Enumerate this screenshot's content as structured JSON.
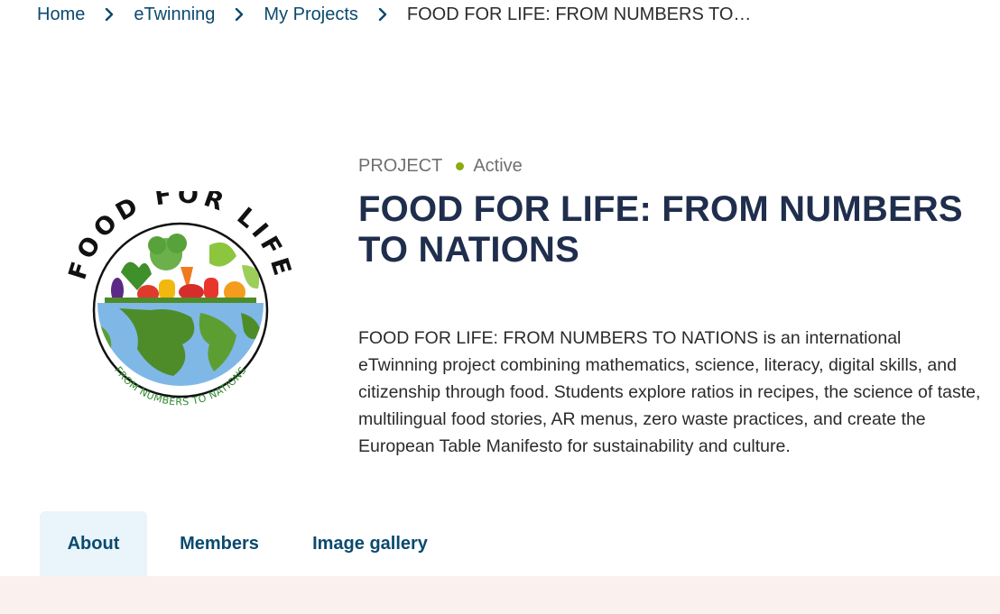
{
  "breadcrumb": {
    "items": [
      "Home",
      "eTwinning",
      "My Projects"
    ],
    "current": "FOOD FOR LIFE: FROM NUMBERS TO…"
  },
  "project": {
    "type_label": "PROJECT",
    "status": "Active",
    "status_color": "#8bab12",
    "title": "FOOD FOR LIFE: FROM NUMBERS TO NATIONS",
    "description": "FOOD FOR LIFE: FROM NUMBERS TO NATIONS is an international eTwinning project combining mathematics, science, literacy, digital skills, and citizenship through food. Students explore ratios in recipes, the science of taste, multilingual food stories, AR menus, zero waste practices, and create the European Table Manifesto for sustainability and culture."
  },
  "logo": {
    "top_text": "FOOD FOR LIFE",
    "bottom_text": "FROM NUMBERS TO NATIONS"
  },
  "tabs": [
    {
      "label": "About",
      "active": true
    },
    {
      "label": "Members",
      "active": false
    },
    {
      "label": "Image gallery",
      "active": false
    }
  ],
  "colors": {
    "link": "#0a4a6e",
    "title": "#1f2e4d",
    "active_tab_bg": "#eaf4fb",
    "footer_band": "#faf0ed"
  }
}
